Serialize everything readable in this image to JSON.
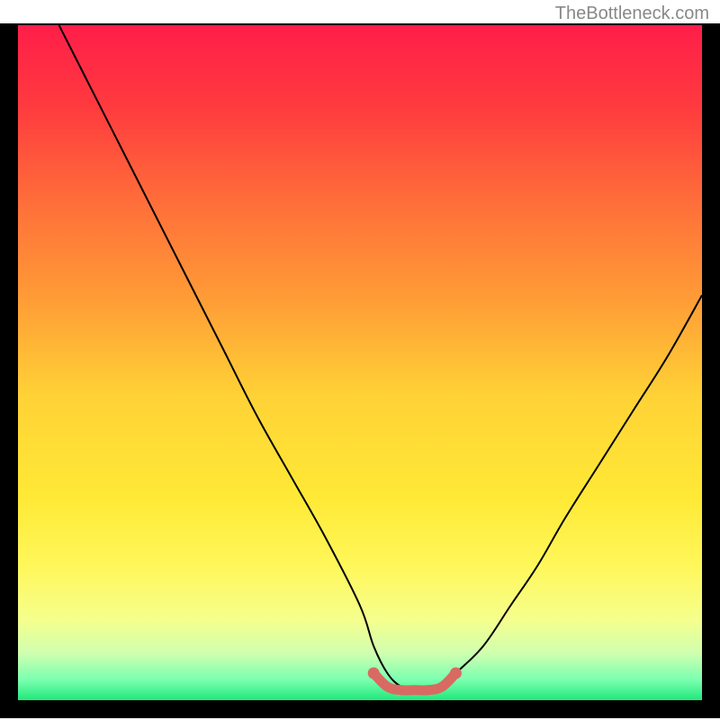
{
  "watermark": "TheBottleneck.com",
  "chart_data": {
    "type": "line",
    "title": "",
    "xlabel": "",
    "ylabel": "",
    "xlim": [
      0,
      100
    ],
    "ylim": [
      0,
      100
    ],
    "series": [
      {
        "name": "curve",
        "x": [
          6,
          10,
          15,
          20,
          25,
          30,
          35,
          40,
          45,
          50,
          52,
          54,
          56,
          58,
          60,
          62,
          64,
          68,
          72,
          76,
          80,
          85,
          90,
          95,
          100
        ],
        "y": [
          100,
          92,
          82,
          72,
          62,
          52,
          42,
          33,
          24,
          14,
          8,
          4,
          2,
          1.5,
          1.5,
          2,
          4,
          8,
          14,
          20,
          27,
          35,
          43,
          51,
          60
        ]
      },
      {
        "name": "flat-segment",
        "x": [
          52,
          54,
          56,
          58,
          60,
          62,
          64
        ],
        "y": [
          4,
          2,
          1.5,
          1.5,
          1.5,
          2,
          4
        ]
      }
    ],
    "gradient_stops": [
      {
        "offset": 0.0,
        "color": "#ff1e49"
      },
      {
        "offset": 0.12,
        "color": "#ff3a3f"
      },
      {
        "offset": 0.25,
        "color": "#ff6a3a"
      },
      {
        "offset": 0.4,
        "color": "#ff9a36"
      },
      {
        "offset": 0.55,
        "color": "#ffd236"
      },
      {
        "offset": 0.7,
        "color": "#ffe936"
      },
      {
        "offset": 0.8,
        "color": "#fff75a"
      },
      {
        "offset": 0.88,
        "color": "#f6ff8c"
      },
      {
        "offset": 0.93,
        "color": "#d0ffb0"
      },
      {
        "offset": 0.97,
        "color": "#7affb0"
      },
      {
        "offset": 1.0,
        "color": "#20e87a"
      }
    ],
    "highlight_color": "#d86a62",
    "curve_color": "#000000"
  }
}
